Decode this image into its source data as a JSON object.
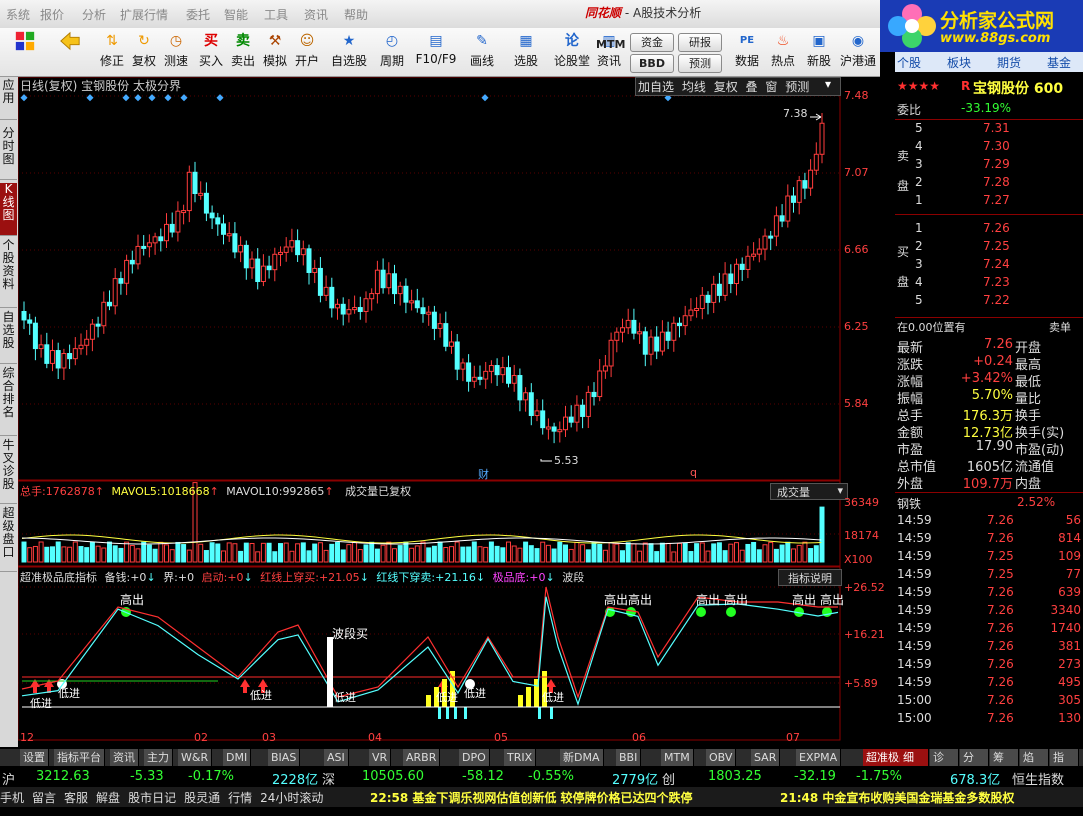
{
  "menu": [
    "系统",
    "报价",
    "分析",
    "扩展行情",
    "委托",
    "智能",
    "工具",
    "资讯",
    "帮助"
  ],
  "brand": {
    "logo": "同花顺",
    "title": "- A股技术分析"
  },
  "watermark": {
    "line1": "分析家公式网",
    "line2": "www.88gs.com"
  },
  "toolbar": [
    {
      "icon": "grid-icon",
      "label": ""
    },
    {
      "icon": "back-arrow-icon",
      "label": ""
    },
    {
      "icon": "up-down-icon",
      "label": "修正"
    },
    {
      "icon": "refresh-icon",
      "label": "复权"
    },
    {
      "icon": "clock-icon",
      "label": "测速"
    },
    {
      "icon": "buy-icon",
      "label": "买入",
      "glyph": "买"
    },
    {
      "icon": "sell-icon",
      "label": "卖出",
      "glyph": "卖"
    },
    {
      "icon": "hammer-icon",
      "label": "模拟"
    },
    {
      "icon": "user-icon",
      "label": "开户"
    },
    {
      "icon": "star-icon",
      "label": "自选股"
    },
    {
      "icon": "period-icon",
      "label": "周期"
    },
    {
      "icon": "f10-icon",
      "label": "F10/F9"
    },
    {
      "icon": "pen-icon",
      "label": "画线"
    },
    {
      "icon": "pick-icon",
      "label": "选股"
    },
    {
      "icon": "lun-icon",
      "label": "论股堂",
      "glyph": "论"
    },
    {
      "icon": "news-icon",
      "label": "资讯"
    }
  ],
  "pills": [
    "MTM",
    "资金",
    "研报",
    "BBD",
    "预测",
    "PE",
    "数据",
    "热点",
    "新股",
    "沪港通"
  ],
  "right_tabs": [
    "个股",
    "板块",
    "期货",
    "基金"
  ],
  "left_strip": [
    "应用",
    "分时图",
    "K线图",
    "个股资料",
    "自选股",
    "综合排名",
    "牛叉诊股",
    "超级盘口"
  ],
  "chart": {
    "title": "日线(复权) 宝钢股份 太极分界",
    "buttons": [
      "加自选",
      "均线",
      "复权",
      "叠",
      "窗",
      "预测"
    ],
    "price_axis": [
      "7.48",
      "7.07",
      "6.66",
      "6.25",
      "5.84"
    ],
    "high_label": "7.38",
    "low_label": "5.53",
    "markers": [
      "财",
      "q"
    ],
    "volume": {
      "total_label": "总手:",
      "total": "1762878",
      "ma5_label": "MAVOL5:",
      "ma5": "1018668",
      "ma10_label": "MAVOL10:",
      "ma10": "992865",
      "note": "成交量已复权",
      "selector": "成交量",
      "axis": [
        "36349",
        "18174",
        "X100"
      ]
    },
    "indicator": {
      "name": "超准极品底指标",
      "items": [
        {
          "k": "备钱:",
          "v": "+0"
        },
        {
          "k": "界:",
          "v": "+0"
        },
        {
          "k": "启动:",
          "v": "+0"
        },
        {
          "k": "红线上穿买:",
          "v": "+21.05"
        },
        {
          "k": "红线下穿卖:",
          "v": "+21.16"
        },
        {
          "k": "极品底:",
          "v": "+0"
        }
      ],
      "wave": "波段",
      "help": "指标说明",
      "axis": [
        "+26.52",
        "+16.21",
        "+5.89"
      ],
      "labels": {
        "high": "高出",
        "wave_buy": "波段买",
        "low": "低进"
      }
    },
    "months": [
      "12",
      "02",
      "03",
      "04",
      "05",
      "06",
      "07"
    ]
  },
  "quote": {
    "stock": "宝钢股份 600",
    "stars": "★★★★",
    "wei_bi_label": "委比",
    "wei_bi": "-33.19%",
    "sell_label": "卖盘",
    "buy_label": "买盘",
    "asks": [
      {
        "n": "5",
        "p": "7.31"
      },
      {
        "n": "4",
        "p": "7.30"
      },
      {
        "n": "3",
        "p": "7.29"
      },
      {
        "n": "2",
        "p": "7.28"
      },
      {
        "n": "1",
        "p": "7.27"
      }
    ],
    "bids": [
      {
        "n": "1",
        "p": "7.26"
      },
      {
        "n": "2",
        "p": "7.25"
      },
      {
        "n": "3",
        "p": "7.24"
      },
      {
        "n": "4",
        "p": "7.23"
      },
      {
        "n": "5",
        "p": "7.22"
      }
    ],
    "position": "在0.00位置有",
    "position_r": "卖单",
    "stats": [
      {
        "l": "最新",
        "v": "7.26",
        "r": "开盘"
      },
      {
        "l": "涨跌",
        "v": "+0.24",
        "r": "最高"
      },
      {
        "l": "涨幅",
        "v": "+3.42%",
        "r": "最低"
      },
      {
        "l": "振幅",
        "v": "5.70%",
        "r": "量比"
      },
      {
        "l": "总手",
        "v": "176.3万",
        "r": "换手"
      },
      {
        "l": "金额",
        "v": "12.73亿",
        "r": "换手(实)"
      },
      {
        "l": "市盈",
        "v": "17.90",
        "r": "市盈(动)"
      },
      {
        "l": "总市值",
        "v": "1605亿",
        "r": "流通值"
      },
      {
        "l": "外盘",
        "v": "109.7万",
        "r": "内盘"
      }
    ],
    "sector": "钢铁",
    "sector_pct": "2.52%",
    "ticks": [
      {
        "t": "14:59",
        "p": "7.26",
        "v": "56"
      },
      {
        "t": "14:59",
        "p": "7.26",
        "v": "814"
      },
      {
        "t": "14:59",
        "p": "7.25",
        "v": "109"
      },
      {
        "t": "14:59",
        "p": "7.25",
        "v": "77"
      },
      {
        "t": "14:59",
        "p": "7.26",
        "v": "639"
      },
      {
        "t": "14:59",
        "p": "7.26",
        "v": "3340"
      },
      {
        "t": "14:59",
        "p": "7.26",
        "v": "1740"
      },
      {
        "t": "14:59",
        "p": "7.26",
        "v": "381"
      },
      {
        "t": "14:59",
        "p": "7.26",
        "v": "273"
      },
      {
        "t": "14:59",
        "p": "7.26",
        "v": "495"
      },
      {
        "t": "15:00",
        "p": "7.26",
        "v": "305"
      },
      {
        "t": "15:00",
        "p": "7.26",
        "v": "130"
      }
    ],
    "bottom_tabs": [
      "细",
      "诊",
      "分",
      "筹",
      "焰",
      "指"
    ]
  },
  "bottom_tabs": [
    "设置",
    "指标平台",
    "资讯",
    "主力",
    "W&R",
    "DMI",
    "BIAS",
    "ASI",
    "VR",
    "ARBR",
    "DPO",
    "TRIX",
    "新DMA",
    "BBI",
    "MTM",
    "OBV",
    "SAR",
    "EXPMA",
    "超准极品底指标"
  ],
  "index_bar": [
    {
      "name": "沪",
      "v": "3212.63",
      "c": "-5.33",
      "p": "-0.17%",
      "a": "2228亿"
    },
    {
      "name": "深",
      "v": "10505.60",
      "c": "-58.12",
      "p": "-0.55%",
      "a": "2779亿"
    },
    {
      "name": "创",
      "v": "1803.25",
      "c": "-32.19",
      "p": "-1.75%",
      "a": "678.3亿"
    },
    {
      "name": "恒生指数"
    }
  ],
  "ticker": {
    "links": [
      "手机",
      "留言",
      "客服",
      "解盘",
      "股市日记",
      "股灵通",
      "行情",
      "24小时滚动"
    ],
    "news1": "22:58 基金下调乐视网估值创新低 较停牌价格已达四个跌停",
    "news2": "21:48 中金宣布收购美国金瑞基金多数股权"
  },
  "colors": {
    "up": "#ff3c3c",
    "down": "#54ffff",
    "yellow": "#ffff00",
    "white": "#ffffff"
  }
}
